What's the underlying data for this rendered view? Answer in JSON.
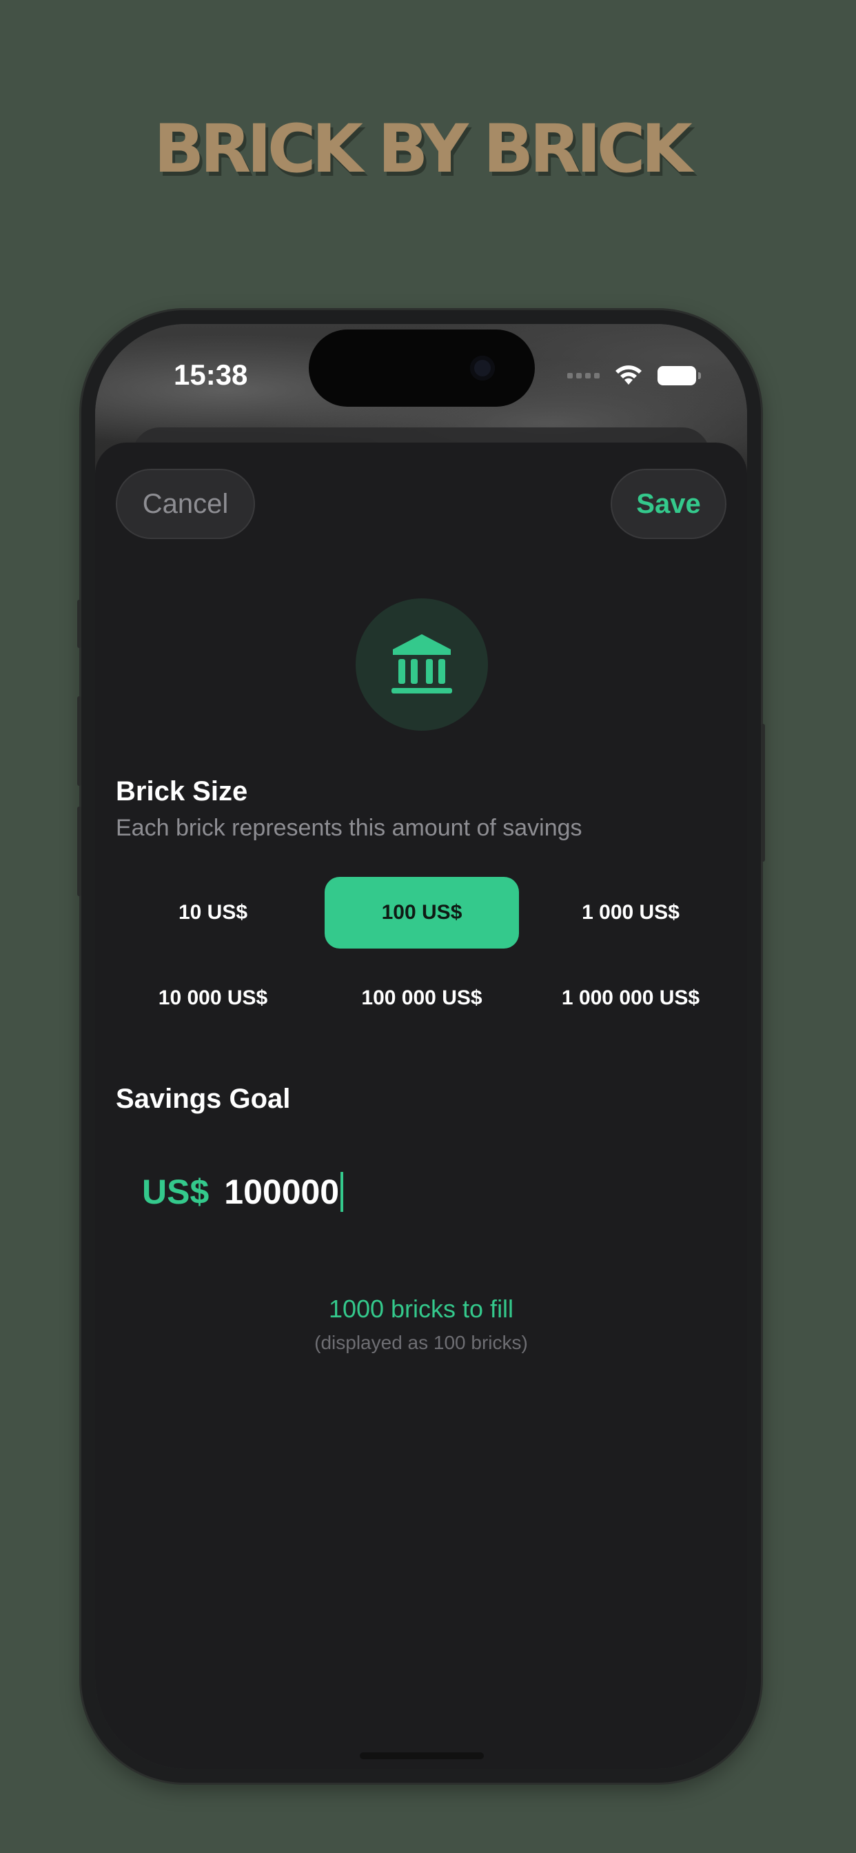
{
  "promo": {
    "headline": "BRICK BY BRICK",
    "headline_color": "#a78b66",
    "background_color": "#445246"
  },
  "status_bar": {
    "time": "15:38",
    "icons": [
      "signal-icon",
      "wifi-icon",
      "battery-icon"
    ]
  },
  "toolbar": {
    "cancel_label": "Cancel",
    "save_label": "Save"
  },
  "header_icon": "bank-icon",
  "brick_size": {
    "title": "Brick Size",
    "subtitle": "Each brick represents this amount of savings",
    "options": [
      {
        "label": "10 US$",
        "selected": false
      },
      {
        "label": "100 US$",
        "selected": true
      },
      {
        "label": "1 000 US$",
        "selected": false
      },
      {
        "label": "10 000 US$",
        "selected": false
      },
      {
        "label": "100 000 US$",
        "selected": false
      },
      {
        "label": "1 000 000 US$",
        "selected": false
      }
    ]
  },
  "savings_goal": {
    "title": "Savings Goal",
    "currency": "US$",
    "value": "100000"
  },
  "summary": {
    "bricks_to_fill": "1000 bricks to fill",
    "displayed_as": "(displayed as 100 bricks)"
  },
  "colors": {
    "accent": "#34c98c",
    "sheet_background": "#1c1c1e",
    "icon_circle": "#21342c"
  }
}
